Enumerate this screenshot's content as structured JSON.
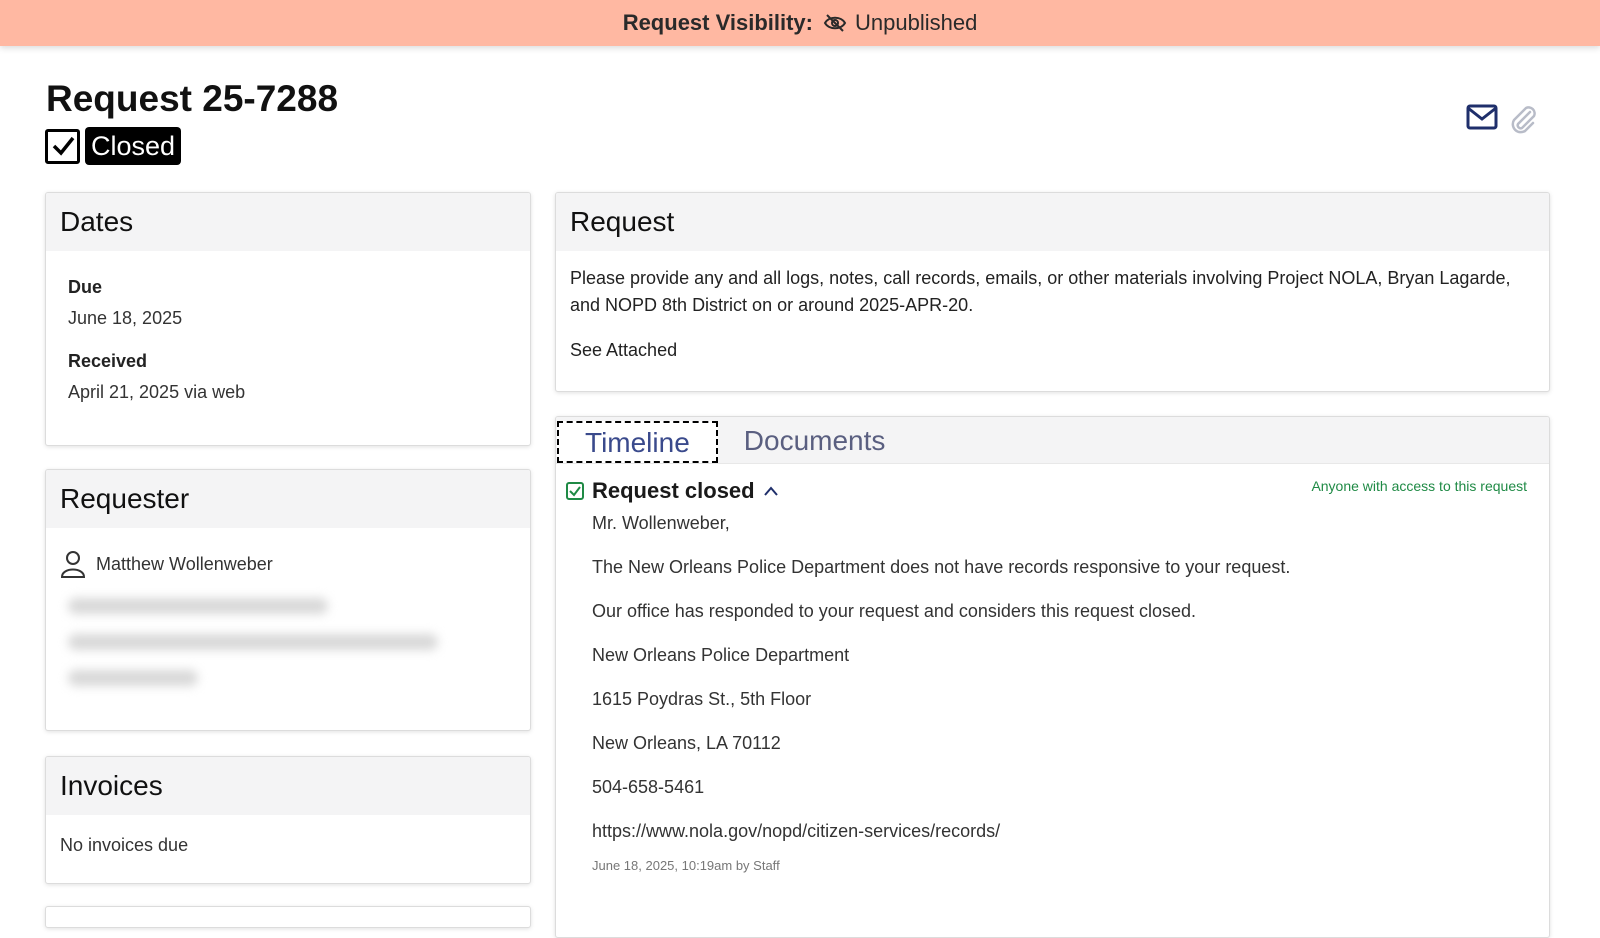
{
  "banner": {
    "label": "Request Visibility:",
    "value": "Unpublished",
    "icon": "eye-slash-icon"
  },
  "request_title": "Request 25-7288",
  "status": {
    "label": "Closed",
    "icon": "checkbox-checked-icon"
  },
  "toolbar": {
    "icons": [
      "envelope-icon",
      "paperclip-icon"
    ]
  },
  "dates": {
    "heading": "Dates",
    "due_label": "Due",
    "due_value": "June 18, 2025",
    "received_label": "Received",
    "received_value": "April 21, 2025 via web"
  },
  "requester": {
    "heading": "Requester",
    "name": "Matthew Wollenweber"
  },
  "invoices": {
    "heading": "Invoices",
    "text": "No invoices due"
  },
  "request": {
    "heading": "Request",
    "body": "Please provide any and all logs, notes, call records, emails, or other materials involving Project NOLA, Bryan Lagarde, and NOPD 8th District on or around 2025-APR-20.",
    "note": "See Attached"
  },
  "tabs": [
    {
      "label": "Timeline",
      "active": true
    },
    {
      "label": "Documents",
      "active": false
    }
  ],
  "timeline": {
    "title": "Request closed",
    "visibility": "Anyone with access to this request",
    "lines": [
      "Mr. Wollenweber,",
      "The New Orleans Police Department does not have records responsive to your request.",
      "Our office has responded to your request and considers this request closed.",
      "New Orleans Police Department",
      "1615 Poydras St., 5th Floor",
      "New Orleans, LA 70112",
      "504-658-5461",
      "https://www.nola.gov/nopd/citizen-services/records/"
    ],
    "meta": "June 18, 2025, 10:19am by Staff"
  },
  "colors": {
    "banner": "#ffb8a2",
    "accent": "#1f2f6b",
    "visibility": "#1f8a45",
    "tab_active": "#3a4a8c"
  }
}
